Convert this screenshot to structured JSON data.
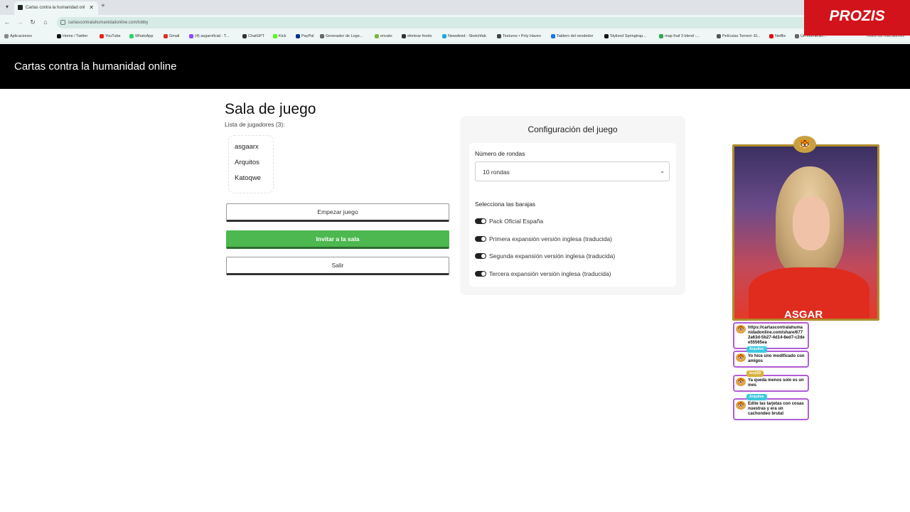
{
  "browser": {
    "tab_title": "Cartas contra la humanidad onl",
    "url": "cartascontralahumanidadonline.com/lobby",
    "bookmarks": [
      {
        "label": "Aplicaciones",
        "color": "#888888"
      },
      {
        "label": "Home / Twitter",
        "color": "#111111"
      },
      {
        "label": "YouTube",
        "color": "#e62117"
      },
      {
        "label": "WhatsApp",
        "color": "#25d366"
      },
      {
        "label": "Gmail",
        "color": "#d93025"
      },
      {
        "label": "(4) asgaroficial - T...",
        "color": "#9146ff"
      },
      {
        "label": "ChatGPT",
        "color": "#333333"
      },
      {
        "label": "Kick",
        "color": "#53fc18"
      },
      {
        "label": "PayPal",
        "color": "#003087"
      },
      {
        "label": "Generador de Logo...",
        "color": "#666666"
      },
      {
        "label": "envato",
        "color": "#82b440"
      },
      {
        "label": "eliminar fondo",
        "color": "#333333"
      },
      {
        "label": "Newsfeed - Sketchfab",
        "color": "#1caad9"
      },
      {
        "label": "Textures • Poly Haven",
        "color": "#444444"
      },
      {
        "label": "Tablero del vendedor",
        "color": "#1a73e8"
      },
      {
        "label": "Stylized Springtrap...",
        "color": "#111111"
      },
      {
        "label": "map fnaf 3 blend -...",
        "color": "#34a853"
      },
      {
        "label": "Películas Torrent- El...",
        "color": "#555555"
      },
      {
        "label": "Netflix",
        "color": "#e50914"
      },
      {
        "label": "Un momento...",
        "color": "#666666"
      }
    ],
    "bookmarks_right": "Todos los marcadores"
  },
  "site": {
    "title": "Cartas contra la humanidad online"
  },
  "lobby": {
    "title": "Sala de juego",
    "players_label": "Lista de jugadores (3):",
    "players": [
      "asgaarx",
      "Arquitos",
      "Katoqwe"
    ],
    "start_button": "Empezar juego",
    "invite_button": "Invitar a la sala",
    "exit_button": "Salir"
  },
  "config": {
    "title": "Configuración del juego",
    "rounds_label": "Número de rondas",
    "rounds_value": "10 rondas",
    "decks_label": "Selecciona las barajas",
    "decks": [
      {
        "label": "Pack Oficial España",
        "enabled": true
      },
      {
        "label": "Primera expansión versión inglesa (traducida)",
        "enabled": true
      },
      {
        "label": "Segunda expansión versión inglesa (traducida)",
        "enabled": true
      },
      {
        "label": "Tercera expansión versión inglesa (traducida)",
        "enabled": true
      }
    ]
  },
  "overlay": {
    "brand": "PROZIS",
    "streamer_name": "ASGAR",
    "chat": [
      {
        "user": "",
        "text": "https://cartascontralahumanidadonline.com/share/6772a63d-5b27-4d14-8ed7-c2dee55565ea"
      },
      {
        "user": "Arquitos",
        "text": "Yo hice uno modificado con amigos"
      },
      {
        "user": "borji92",
        "text": "Ya queda menos solo es un mes"
      },
      {
        "user": "Arquitos",
        "text": "Edite las tarjetas con cosas nuestras y era un cachondeo brutal"
      }
    ]
  }
}
